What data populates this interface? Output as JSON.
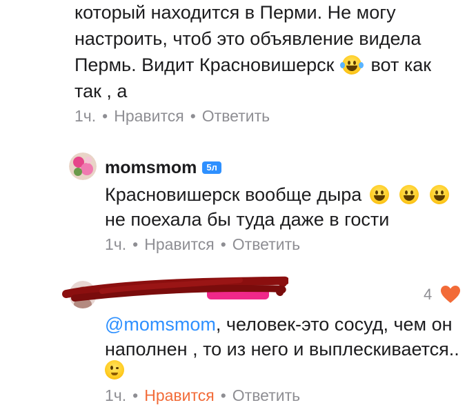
{
  "comment1": {
    "lines": [
      "который находится в Перми. Не могу",
      "настроить, чтоб это объявление видела",
      "Пермь. Видит Красновишерск",
      "вот как",
      "так , а"
    ],
    "emoji": "face-with-tears-of-joy-icon",
    "meta": {
      "time": "1ч.",
      "like": "Нравится",
      "reply": "Ответить"
    }
  },
  "comment2": {
    "username": "momsmom",
    "badge": "5л",
    "lines": [
      "Красновишерск вообще дыра",
      "не поехала бы туда даже в гости"
    ],
    "emojis": [
      "grinning-face-icon",
      "grinning-face-icon",
      "grinning-face-icon"
    ],
    "meta": {
      "time": "1ч.",
      "like": "Нравится",
      "reply": "Ответить"
    }
  },
  "comment3": {
    "like_count": "4",
    "mention": "@momsmom",
    "lines": [
      ", человек-это сосуд, чем он",
      "наполнен , то из него и выплескивается.."
    ],
    "emoji": "winking-face-icon",
    "meta": {
      "time": "1ч.",
      "like": "Нравится",
      "reply": "Ответить"
    },
    "like_color": "#f26b38"
  },
  "colors": {
    "accent": "#2e90ff",
    "heart": "#f26b38",
    "muted": "#8e8e93"
  }
}
